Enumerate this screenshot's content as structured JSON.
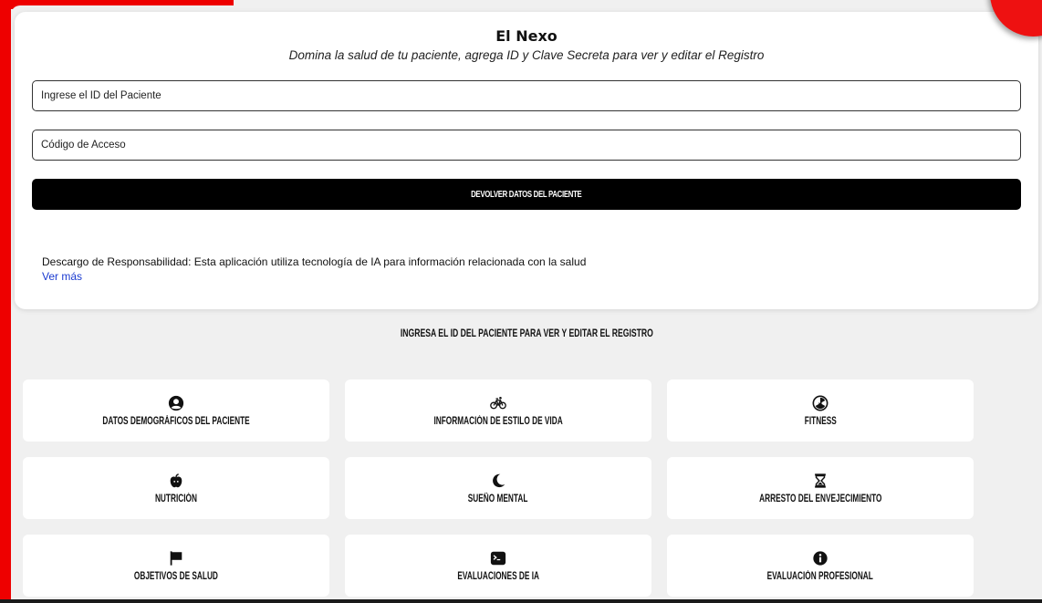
{
  "header": {
    "title": "El Nexo",
    "subtitle": "Domina la salud de tu paciente, agrega ID y Clave Secreta para ver y editar el Registro"
  },
  "form": {
    "patient_id_placeholder": "Ingrese el ID del Paciente",
    "access_code_placeholder": "Código de Acceso",
    "submit_label": "DEVOLVER DATOS DEL PACIENTE"
  },
  "disclaimer": {
    "text": "Descargo de Responsabilidad: Esta aplicación utiliza tecnología de IA para información relacionada con la salud",
    "link": "Ver más"
  },
  "prompt": "INGRESA EL ID DEL PACIENTE PARA VER Y EDITAR EL REGISTRO",
  "tiles": [
    {
      "label": "DATOS DEMOGRÁFICOS DEL PACIENTE",
      "icon": "user-circle-icon"
    },
    {
      "label": "INFORMACIÓN DE ESTILO DE VIDA",
      "icon": "bicycle-icon"
    },
    {
      "label": "FITNESS",
      "icon": "radiation-icon"
    },
    {
      "label": "NUTRICIÓN",
      "icon": "apple-icon"
    },
    {
      "label": "SUEÑO MENTAL",
      "icon": "moon-icon"
    },
    {
      "label": "ARRESTO DEL ENVEJECIMIENTO",
      "icon": "hourglass-icon"
    },
    {
      "label": "OBJETIVOS DE SALUD",
      "icon": "flag-icon"
    },
    {
      "label": "EVALUACIONES DE IA",
      "icon": "terminal-icon"
    },
    {
      "label": "EVALUACIÓN PROFESIONAL",
      "icon": "info-icon"
    }
  ],
  "colors": {
    "accent_red": "#ee0000",
    "background": "#f0f0f0",
    "button": "#000000",
    "link": "#1a3ad0"
  }
}
